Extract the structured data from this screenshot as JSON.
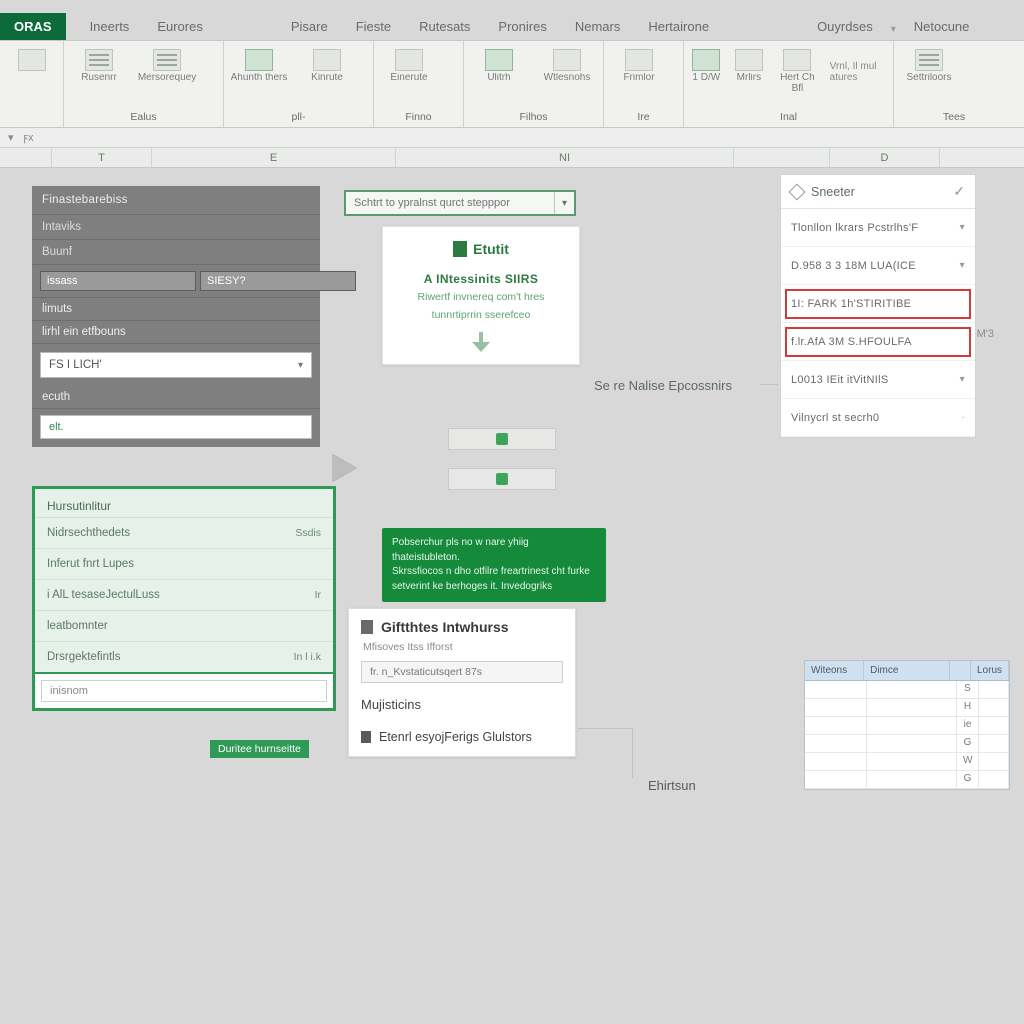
{
  "tabs": {
    "active": "ORAS",
    "items": [
      "Ineerts",
      "Eurores",
      "Pisare",
      "Fieste",
      "Rutesats",
      "Pronires",
      "Nemars",
      "Hertairone",
      "Ouyrdses",
      "Netocune"
    ]
  },
  "ribbon": {
    "groups": [
      {
        "label": "Ealus",
        "buttons": [
          {
            "label": "Rusenrr"
          },
          {
            "label": "Mersorequey"
          }
        ]
      },
      {
        "label": "pll-",
        "buttons": [
          {
            "label": "Ahunth thers"
          },
          {
            "label": "Kinrute"
          }
        ]
      },
      {
        "label": "Finno",
        "buttons": [
          {
            "label": "Einerute"
          }
        ]
      },
      {
        "label": "Filhos",
        "buttons": [
          {
            "label": "Ulitrh"
          },
          {
            "label": "Wtlesnohs"
          }
        ]
      },
      {
        "label": "Ire",
        "buttons": [
          {
            "label": "Frimlor"
          }
        ]
      },
      {
        "label": "Inal",
        "buttons": [
          {
            "label": "1 D/W"
          },
          {
            "label": "Mrlirs"
          },
          {
            "label": "Hert Ch Bfl"
          }
        ]
      },
      {
        "label": "Tees",
        "buttons": [
          {
            "label": "Settriloors"
          }
        ]
      }
    ],
    "extra_label": "Vrnl, Il mul atures"
  },
  "col_headers": [
    "T",
    "E",
    "NI",
    "D"
  ],
  "left_panel": {
    "title": "Finastebarebiss",
    "rows1": [
      "Intaviks",
      "Buunf"
    ],
    "input_a": "issass",
    "input_b": "SIESY?",
    "rows2": [
      "limuts",
      "lirhl ein etfbouns"
    ],
    "select_value": "FS I LICH'",
    "rows3": [
      "ecuth"
    ],
    "search_value": "elt."
  },
  "suggestions": {
    "header": "Hursutinlitur",
    "items": [
      {
        "label": "Nidrsechthedets",
        "badge": "Ssdis"
      },
      {
        "label": "Inferut fnrt  Lupes",
        "badge": ""
      },
      {
        "label": "i AlL tesaseJectulLuss",
        "badge": "Ir"
      },
      {
        "label": "leatbomnter",
        "badge": ""
      },
      {
        "label": "Drsrgektefintls",
        "badge": "In l i.k"
      }
    ],
    "input_value": "inisnom"
  },
  "small_tag": "Duritee  hurnseitte",
  "center_search": {
    "placeholder": "Schtrt to ypralnst qurct stepppor"
  },
  "promo": {
    "logo": "Etutit",
    "headline": "A INtessinits SIIRS",
    "sub1": "Riwertf invnereq com't hres",
    "sub2": "tunnrtiprrin sserefceo"
  },
  "tooltip": {
    "l1": "Pobserchur pls no w nare yhiig thateistubleton.",
    "l2": "Skrssfiocos n dho otfilre freartrinest cht furke",
    "l3": "setverint ke berhoges it.       Invedogriks"
  },
  "folders": {
    "title": "Giftthtes Intwhurss",
    "subtitle": "Mfisoves Itss  Ifforst",
    "path": "fr. n_Kvstaticutsqert 87s",
    "item1": "Mujisticins",
    "item2": "Etenrl esyojFerigs Glulstors"
  },
  "callout": {
    "label": "Se re Nalise Epcossnirs"
  },
  "free_label": "Ehirtsun",
  "slicer": {
    "title": "Sneeter",
    "rows": [
      {
        "label": "Tlonllon lkrars Pcstrlhs'F",
        "hl": false
      },
      {
        "label": "D.958 3 3 18M LUA(ICE",
        "hl": false
      },
      {
        "label": "1I: FARK 1h'STIRITIBE",
        "hl": true
      },
      {
        "label": "f.lr.AfA 3M S.HFOULFA",
        "hl": true
      },
      {
        "label": "L0013 IEit itVitNIlS",
        "hl": false
      },
      {
        "label": "Vilnycrl st secrh0",
        "hl": false
      }
    ],
    "side_marker": "M'3"
  },
  "minitable": {
    "headers": [
      "Witeons",
      "Dimce",
      "",
      "Lorus"
    ],
    "col3": [
      "S",
      "H",
      "ie",
      "G",
      "W",
      "G"
    ]
  }
}
